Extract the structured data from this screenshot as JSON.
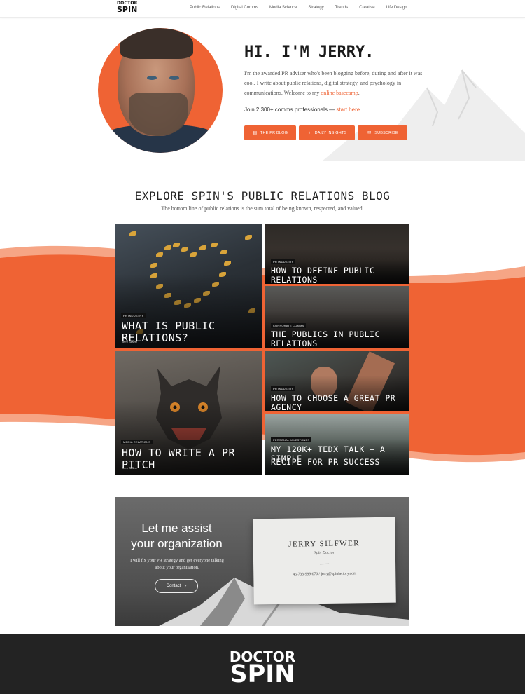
{
  "nav": {
    "logo_line1": "DOCTOR",
    "logo_line2": "SPIN",
    "items": [
      "Public Relations",
      "Digital Comms",
      "Media Science",
      "Strategy",
      "Trends",
      "Creative",
      "Life Design"
    ]
  },
  "hero": {
    "title": "HI. I'M JERRY.",
    "intro_text": "I'm the awarded PR adviser who's been blogging before, during and after it was cool. I write about public relations, digital strategy, and psychology in communications. Welcome to my ",
    "intro_link": "online basecamp",
    "intro_end": ".",
    "join_text": "Join 2,300+ comms professionals — ",
    "join_link": "start here.",
    "buttons": [
      {
        "label": "THE PR BLOG",
        "icon": "document-icon"
      },
      {
        "label": "DAILY INSIGHTS",
        "icon": "lightbulb-icon"
      },
      {
        "label": "SUBSCRIBE",
        "icon": "envelope-icon"
      }
    ]
  },
  "blog_section": {
    "title": "EXPLORE SPIN'S PUBLIC RELATIONS BLOG",
    "subtitle": "The bottom line of public relations is the sum total of being known, respected, and valued."
  },
  "cards": [
    {
      "tag": "PR INDUSTRY",
      "title": "WHAT IS PUBLIC RELATIONS?",
      "author": "Jerry Silfwer"
    },
    {
      "tag": "PR INDUSTRY",
      "title": "HOW TO DEFINE PUBLIC RELATIONS"
    },
    {
      "tag": "CORPORATE COMMS",
      "title": "THE PUBLICS IN PUBLIC RELATIONS"
    },
    {
      "tag": "MEDIA RELATIONS",
      "title": "HOW TO WRITE A PR PITCH",
      "author": "Jerry Silfwer"
    },
    {
      "tag": "PR INDUSTRY",
      "title": "HOW TO CHOOSE A GREAT PR AGENCY"
    },
    {
      "tag": "PERSONAL MILESTONES",
      "title_line1": "MY 120K+ TEDX TALK — A SIMPLE",
      "title_line2": "RECIPE FOR PR SUCCESS"
    }
  ],
  "contact": {
    "heading": "Let me assist your organization",
    "text": "I will fix your PR strategy and get everyone talking about your organisation.",
    "button": "Contact",
    "card_name": "JERRY SILFWER",
    "card_role": "Spin Doctor",
    "card_phone": "46-733-999-070",
    "card_sep": "/",
    "card_email": "jerry@spinfactory.com"
  },
  "footer": {
    "logo_line1": "DOCTOR",
    "logo_line2": "SPIN"
  },
  "colors": {
    "accent": "#ef6334",
    "footer_bg": "#232323"
  }
}
